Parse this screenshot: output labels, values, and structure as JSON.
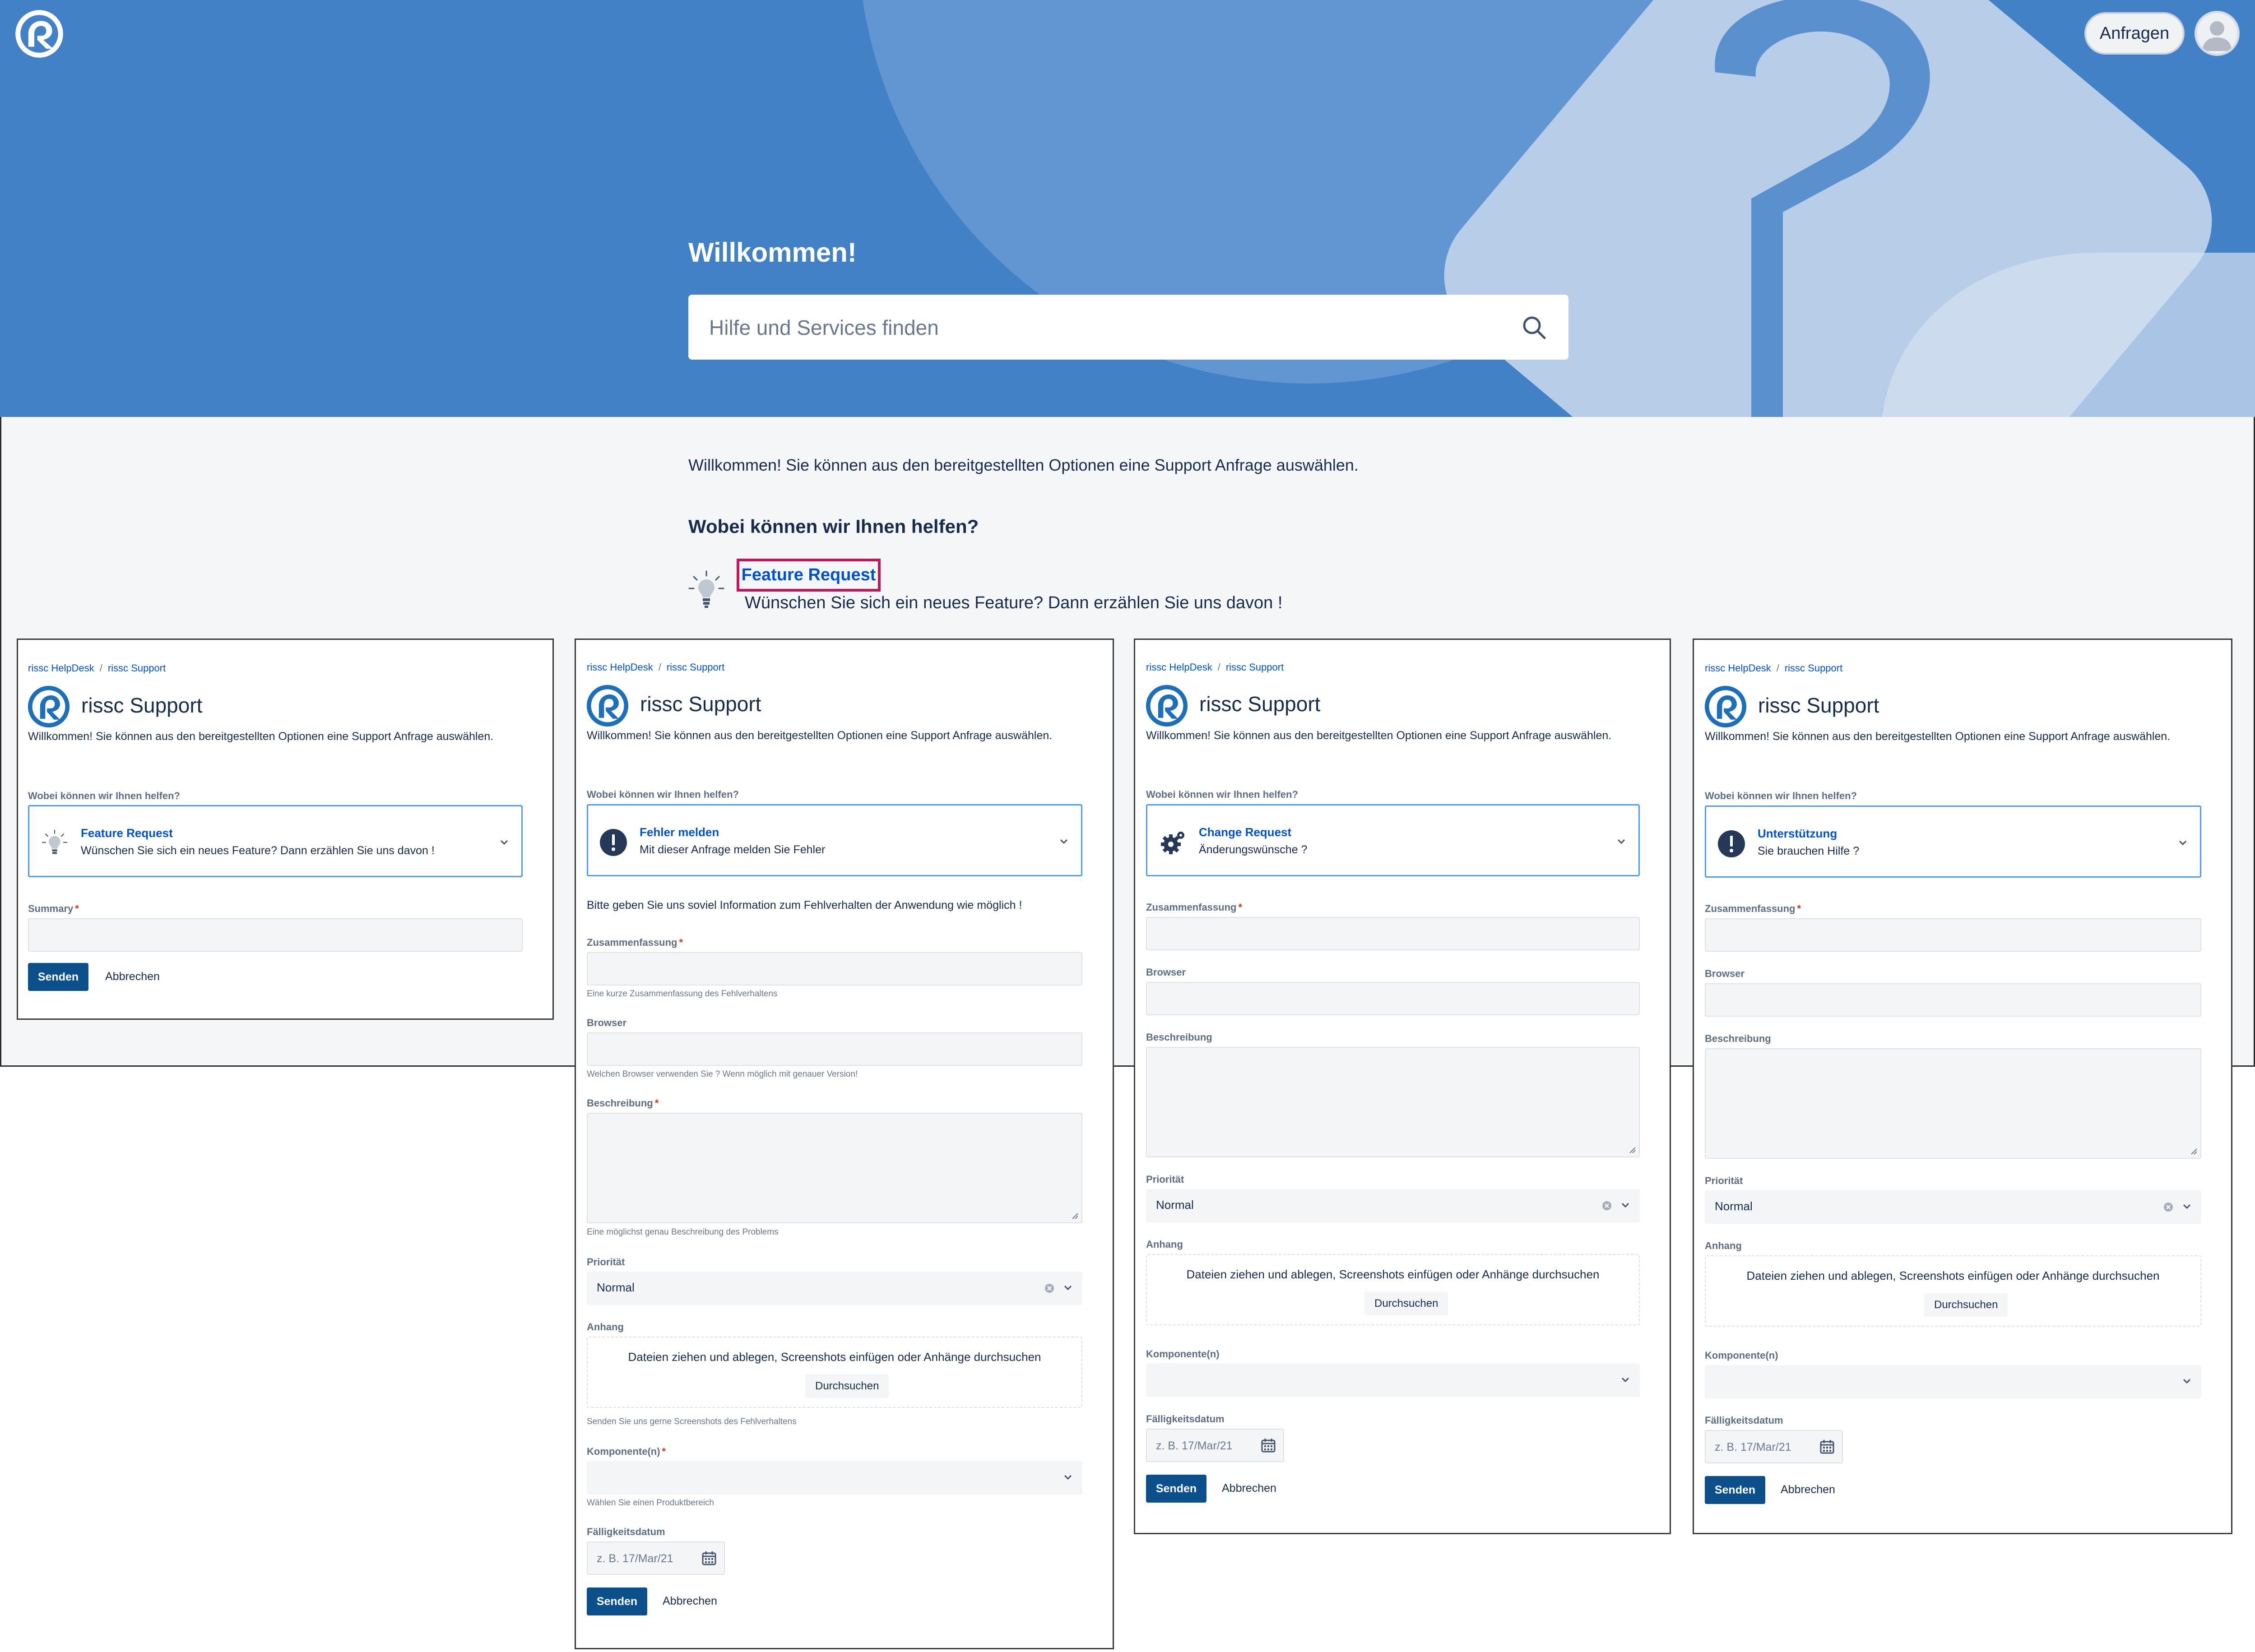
{
  "header": {
    "anfragen_label": "Anfragen",
    "welcome_title": "Willkommen!",
    "search_placeholder": "Hilfe und Services finden"
  },
  "main": {
    "intro": "Willkommen! Sie können aus den bereitgestellten Optionen eine Support Anfrage auswählen.",
    "help_question": "Wobei können wir Ihnen helfen?",
    "feature_request": {
      "label": "Feature Request",
      "description": "Wünschen Sie sich ein neues Feature? Dann erzählen Sie uns davon !"
    }
  },
  "colors": {
    "hero": "#4381c7",
    "link": "#0052cc",
    "highlight": "#c2185b",
    "send_button": "#0b4f8b"
  },
  "panels": {
    "common": {
      "breadcrumb_1": "rissc HelpDesk",
      "breadcrumb_sep": "/",
      "breadcrumb_2": "rissc Support",
      "title": "rissc Support",
      "intro": "Willkommen! Sie können aus den bereitgestellten Optionen eine Support Anfrage auswählen.",
      "help_question": "Wobei können wir Ihnen helfen?",
      "send": "Senden",
      "cancel": "Abbrechen",
      "browse": "Durchsuchen",
      "dropzone": "Dateien ziehen und ablegen, Screenshots einfügen oder Anhänge durchsuchen",
      "priority_label": "Priorität",
      "priority_value": "Normal",
      "attachment_label": "Anhang",
      "components_label": "Komponente(n)",
      "due_date_label": "Fälligkeitsdatum",
      "date_placeholder": "z. B. 17/Mar/21",
      "summary_label": "Zusammenfassung",
      "browser_label": "Browser",
      "description_label": "Beschreibung"
    },
    "feature": {
      "type_name": "Feature Request",
      "type_desc": "Wünschen Sie sich ein neues Feature? Dann erzählen Sie uns davon !",
      "summary_label": "Summary"
    },
    "bug": {
      "type_name": "Fehler melden",
      "type_desc": "Mit dieser Anfrage melden Sie Fehler",
      "instruction": "Bitte geben Sie uns soviel Information zum Fehlverhalten der Anwendung wie möglich !",
      "summary_help": "Eine kurze Zusammenfassung des Fehlverhaltens",
      "browser_help": "Welchen Browser verwenden Sie ? Wenn möglich mit genauer Version!",
      "description_help": "Eine möglichst genau Beschreibung des Problems",
      "attachment_help": "Senden Sie uns gerne Screenshots des Fehlverhaltens",
      "components_help": "Wählen Sie einen Produktbereich"
    },
    "change": {
      "type_name": "Change Request",
      "type_desc": "Änderungswünsche ?"
    },
    "support": {
      "type_name": "Unterstützung",
      "type_desc": "Sie brauchen Hilfe ?"
    }
  }
}
